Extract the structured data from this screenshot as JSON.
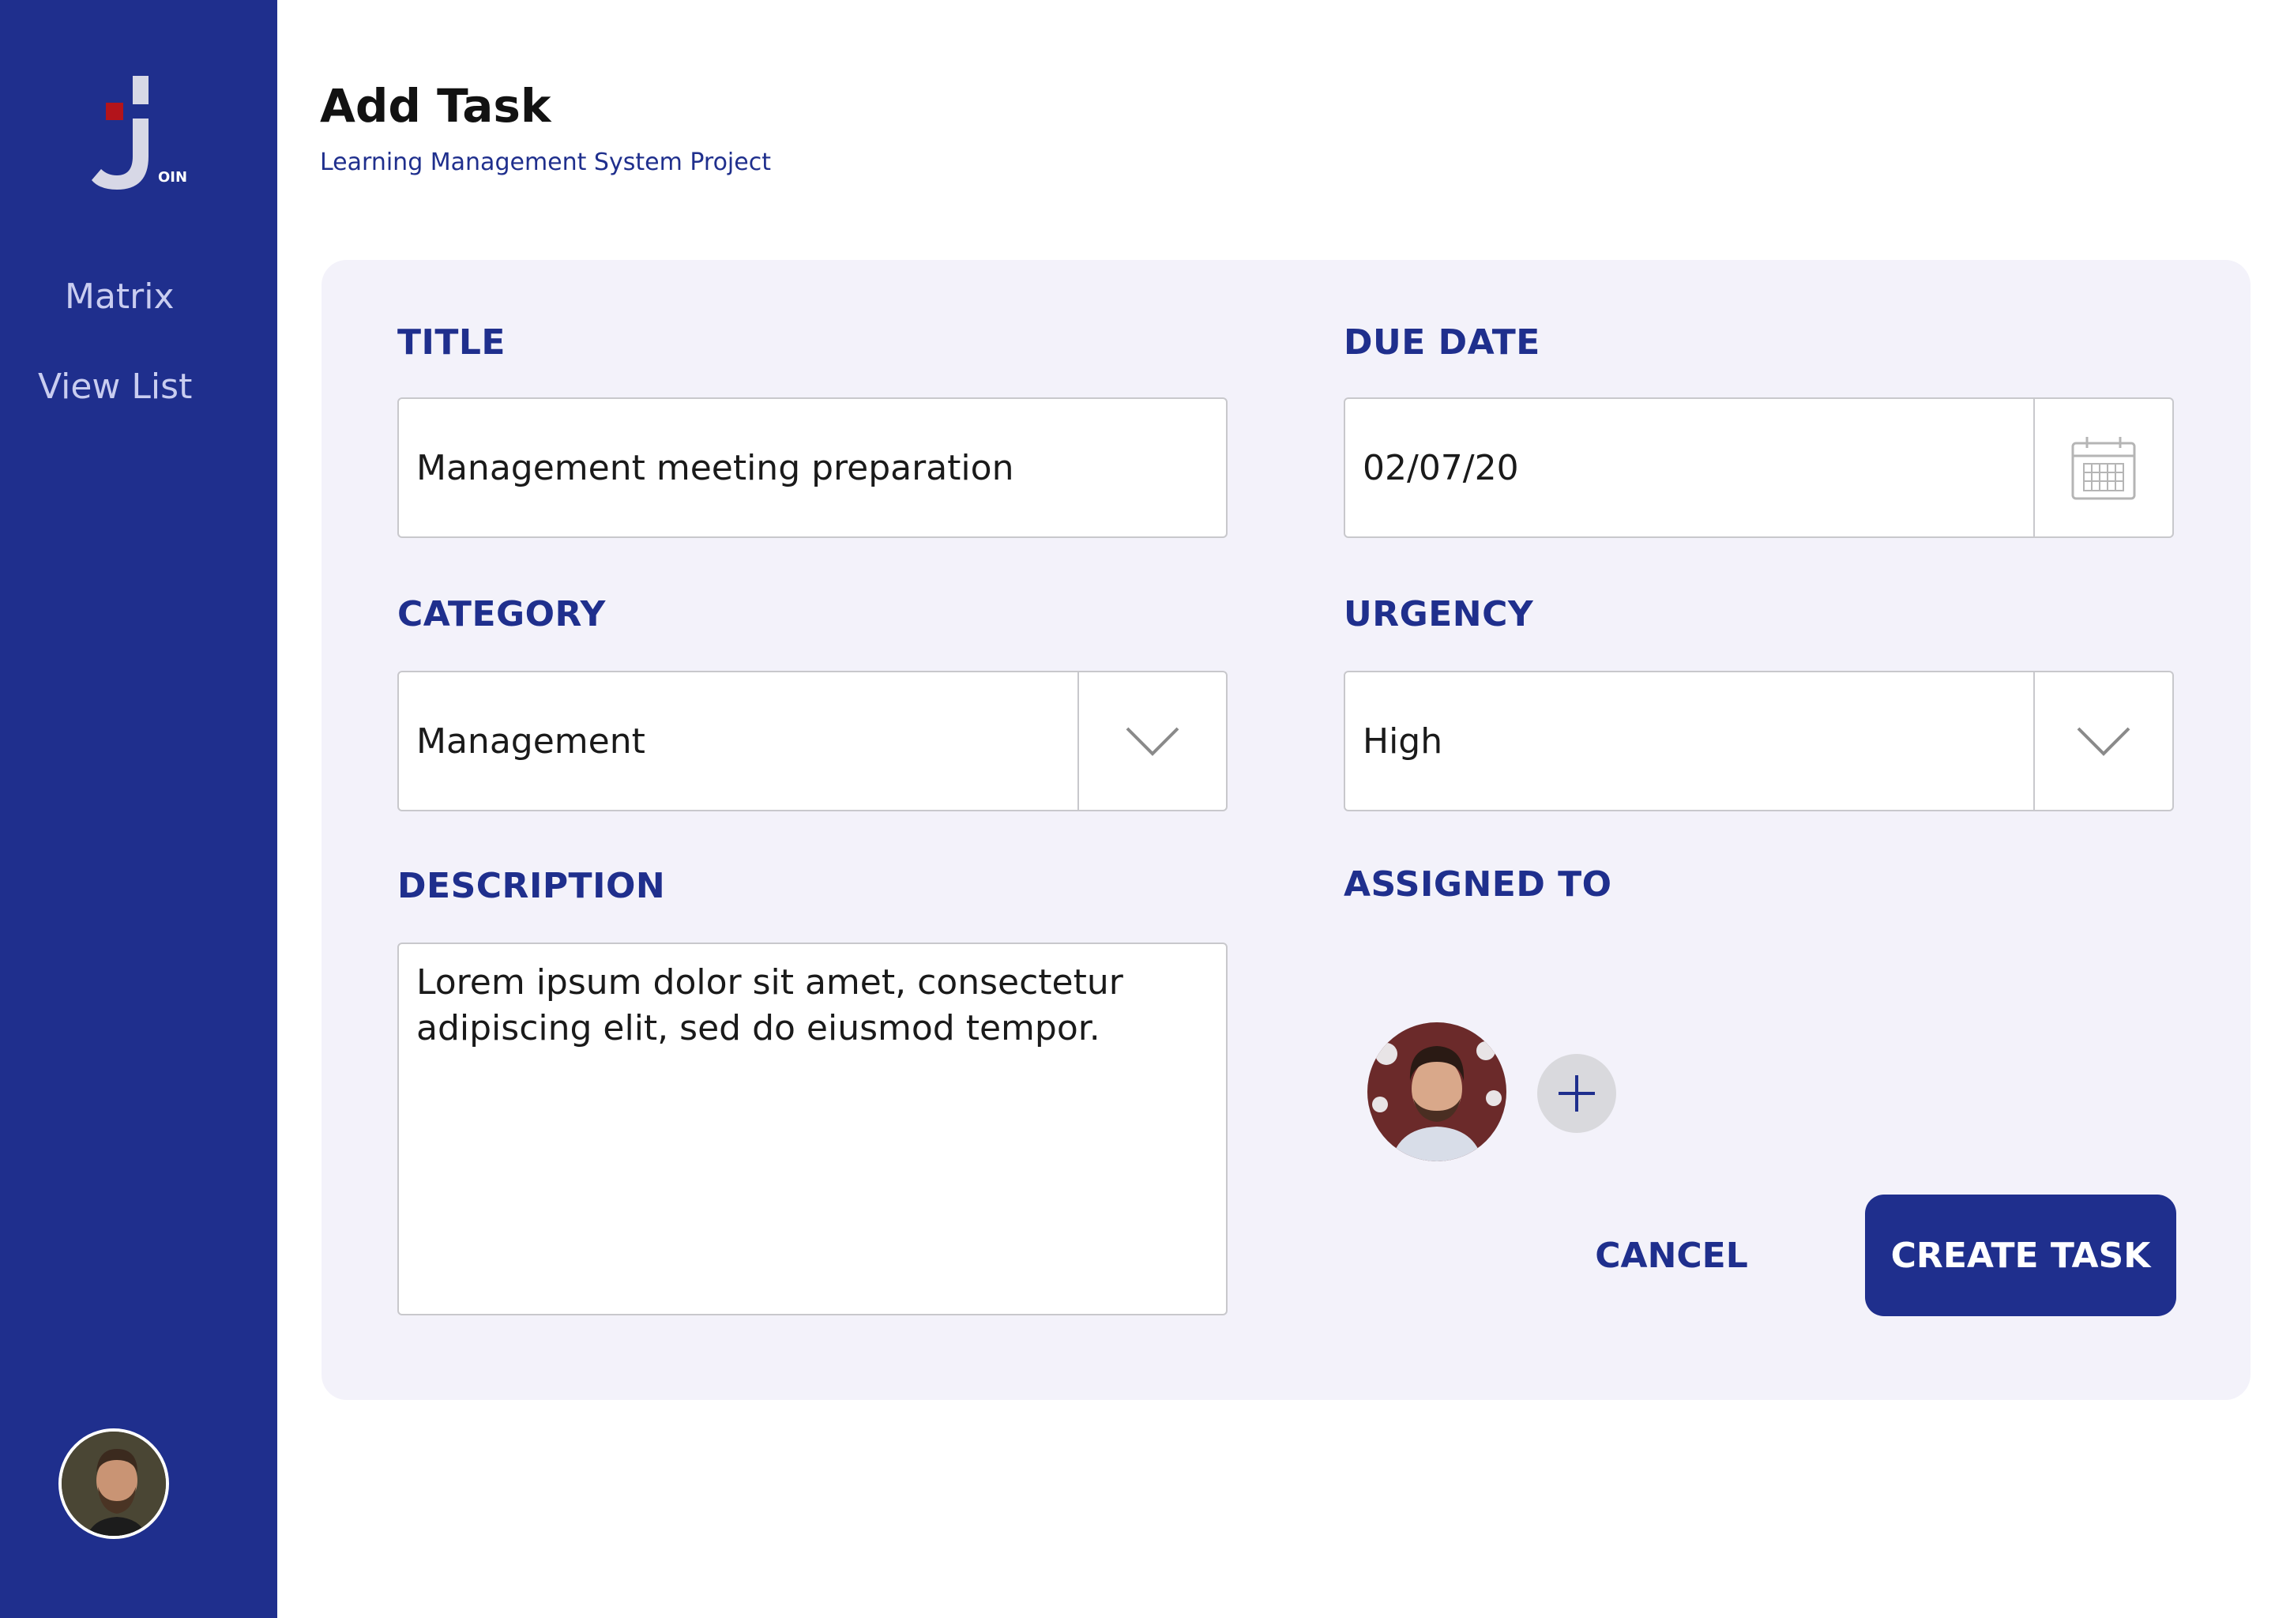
{
  "sidebar": {
    "logo_text": "OIN",
    "nav": [
      {
        "label": "Matrix"
      },
      {
        "label": "View List"
      }
    ]
  },
  "header": {
    "title": "Add Task",
    "subtitle": "Learning Management System Project"
  },
  "form": {
    "title": {
      "label": "TITLE",
      "value": "Management meeting preparation"
    },
    "due_date": {
      "label": "DUE DATE",
      "value": "02/07/20",
      "icon": "calendar-icon"
    },
    "category": {
      "label": "CATEGORY",
      "value": "Management",
      "icon": "chevron-down-icon"
    },
    "urgency": {
      "label": "URGENCY",
      "value": "High",
      "icon": "chevron-down-icon"
    },
    "description": {
      "label": "DESCRIPTION",
      "value": "Lorem ipsum dolor sit amet, consectetur adipiscing elit, sed do eiusmod tempor."
    },
    "assigned_to": {
      "label": "ASSIGNED TO",
      "add_icon": "plus-icon"
    }
  },
  "actions": {
    "cancel_label": "CANCEL",
    "create_label": "CREATE TASK"
  },
  "colors": {
    "primary": "#1f2f8d",
    "card_bg": "#f3f2fa",
    "logo_accent": "#b3141b",
    "logo_main": "#d7d8e6"
  }
}
